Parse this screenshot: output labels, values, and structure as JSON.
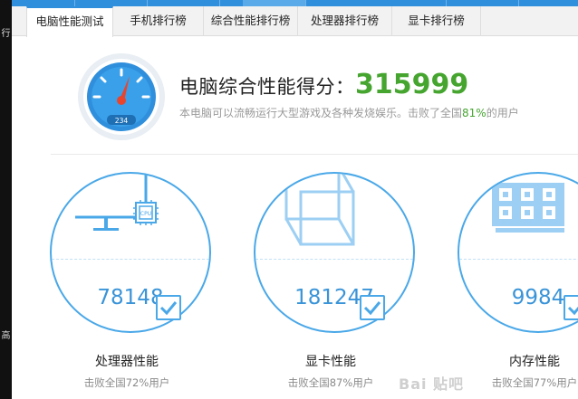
{
  "tabs": [
    {
      "label": "电脑性能测试",
      "active": true
    },
    {
      "label": "手机排行榜",
      "active": false
    },
    {
      "label": "综合性能排行榜",
      "active": false
    },
    {
      "label": "处理器排行榜",
      "active": false
    },
    {
      "label": "显卡排行榜",
      "active": false
    }
  ],
  "left_strip": {
    "top_char": "行",
    "bottom_char": "高"
  },
  "score": {
    "label": "电脑综合性能得分：",
    "value": "315999",
    "desc_prefix": "本电脑可以流畅运行大型游戏及各种发烧娱乐。击败了全国",
    "desc_pct": "81%",
    "desc_suffix": "的用户",
    "gauge_readout": "234"
  },
  "cards": [
    {
      "icon": "monitor-cpu-icon",
      "value": "78148",
      "title": "处理器性能",
      "sub": "击败全国72%用户"
    },
    {
      "icon": "gpu-cube-icon",
      "value": "181247",
      "title": "显卡性能",
      "sub": "击败全国87%用户"
    },
    {
      "icon": "memory-chip-icon",
      "value": "9984",
      "title": "内存性能",
      "sub": "击败全国77%用户"
    }
  ],
  "watermark": "Bai 贴吧",
  "colors": {
    "accent": "#2f8fdc",
    "score_green": "#45a52f",
    "ring_blue": "#4aa8e8"
  }
}
